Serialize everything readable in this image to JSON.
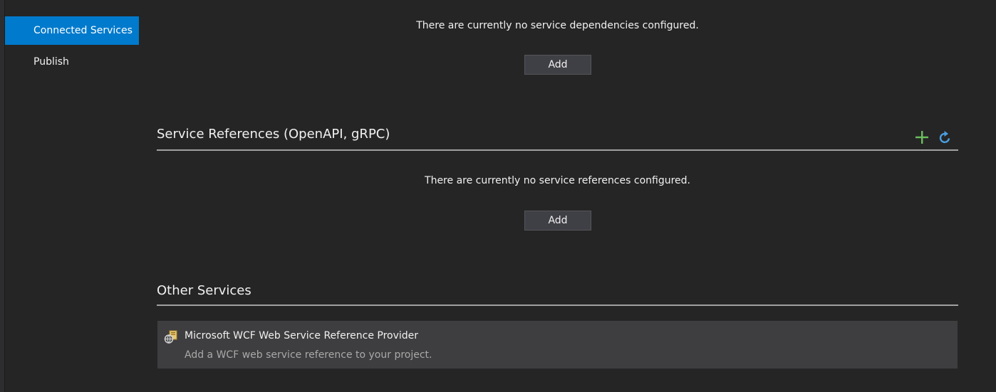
{
  "nav": {
    "items": [
      {
        "label": "Connected Services",
        "active": true
      },
      {
        "label": "Publish",
        "active": false
      }
    ]
  },
  "dependencies": {
    "empty_message": "There are currently no service dependencies configured.",
    "add_label": "Add"
  },
  "service_references": {
    "title": "Service References (OpenAPI, gRPC)",
    "empty_message": "There are currently no service references configured.",
    "add_label": "Add",
    "actions": [
      {
        "icon": "plus-icon",
        "color": "#6bbf5e"
      },
      {
        "icon": "refresh-icon",
        "color": "#4a9fe0"
      }
    ]
  },
  "other_services": {
    "title": "Other Services",
    "items": [
      {
        "icon": "wcf-service-icon",
        "name": "Microsoft WCF Web Service Reference Provider",
        "description": "Add a WCF web service reference to your project."
      }
    ]
  },
  "colors": {
    "background": "#252526",
    "accent": "#007acc",
    "button": "#3f3f46",
    "card": "#3e3e40"
  }
}
